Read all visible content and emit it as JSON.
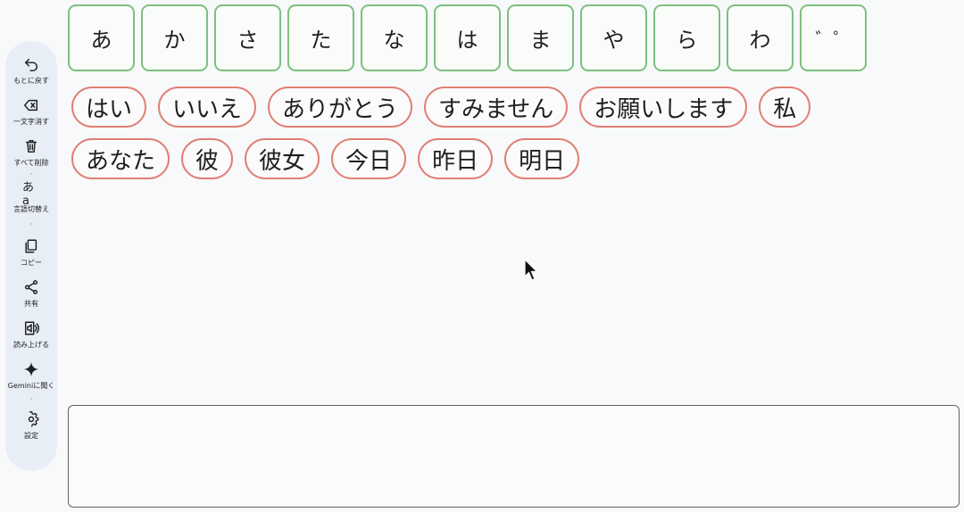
{
  "sidebar": {
    "items": [
      {
        "label": "もとに戻す",
        "icon": "undo-icon"
      },
      {
        "label": "一文字消す",
        "icon": "backspace-icon"
      },
      {
        "label": "すべて削除",
        "icon": "trash-icon"
      },
      {
        "label": "言語切替え",
        "icon": "language-toggle-icon",
        "glyph": "あa"
      },
      {
        "label": "コピー",
        "icon": "copy-icon"
      },
      {
        "label": "共有",
        "icon": "share-icon"
      },
      {
        "label": "読み上げる",
        "icon": "speaker-icon"
      },
      {
        "label": "Geminiに聞く",
        "icon": "sparkle-icon"
      },
      {
        "label": "設定",
        "icon": "gear-icon"
      }
    ]
  },
  "kana": [
    "あ",
    "か",
    "さ",
    "た",
    "な",
    "は",
    "ま",
    "や",
    "ら",
    "わ",
    "゛゜"
  ],
  "chips": {
    "row1": [
      "はい",
      "いいえ",
      "ありがとう",
      "すみません",
      "お願いします",
      "私"
    ],
    "row2": [
      "あなた",
      "彼",
      "彼女",
      "今日",
      "昨日",
      "明日"
    ]
  },
  "colors": {
    "kana_border": "#7cc07f",
    "chip_border": "#e07f74",
    "sidebar_bg": "#e8eef6"
  },
  "textbox": {
    "value": ""
  }
}
